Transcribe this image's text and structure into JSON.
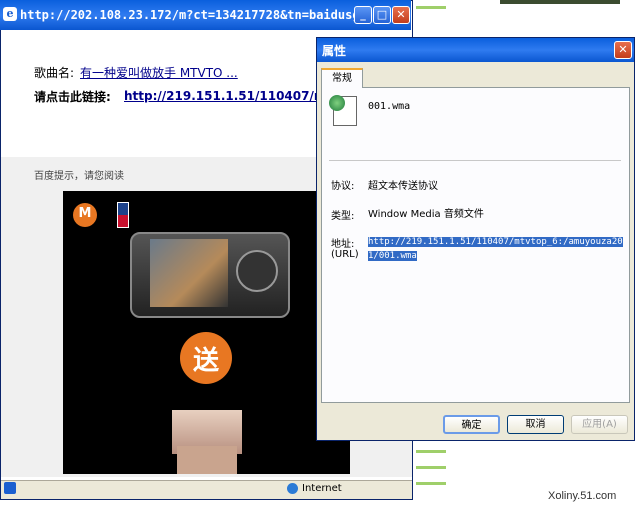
{
  "browser": {
    "title": "http://202.108.23.172/m?ct=134217728&tn=baidusg,...",
    "song_label": "歌曲名:",
    "song_link": "有一种爱叫做放手 MTVTO ...",
    "download_label": "请点击此链接:",
    "download_link": "http://219.151.1.51/110407/mtvtop_6.../1/001.wma",
    "tips": "百度提示，请您阅读",
    "ad_gift_text": "送",
    "status_zone": "Internet"
  },
  "dialog": {
    "title": "属性",
    "tab_general": "常规",
    "file_name": "001.wma",
    "protocol_label": "协议:",
    "protocol_value": "超文本传送协议",
    "type_label": "类型:",
    "type_value": "Window Media 音频文件",
    "address_label": "地址:",
    "address_label2": "(URL)",
    "address_value": "http://219.151.1.51/110407/mtvtop_6:/amuyouza20 1/001.wma",
    "ok_label": "确定",
    "cancel_label": "取消",
    "apply_label": "应用(A)"
  },
  "watermark": "Xoliny.51.com",
  "colors": {
    "title_bar": "#0a5fdd",
    "dialog_bg": "#ece9d8",
    "link": "#00008b",
    "selection": "#316ac5"
  }
}
